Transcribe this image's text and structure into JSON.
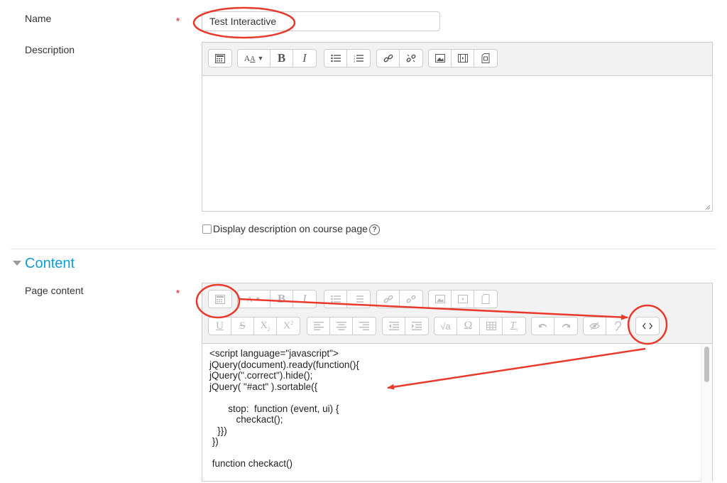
{
  "name_field": {
    "label": "Name",
    "required_marker": "*",
    "value": "Test Interactive"
  },
  "description_field": {
    "label": "Description"
  },
  "display_description": {
    "label": "Display description on course page",
    "checked": false,
    "help_icon": "question-circle-icon"
  },
  "content_section": {
    "title": "Content",
    "collapse_icon": "caret-down-icon"
  },
  "page_content": {
    "label": "Page content",
    "required_marker": "*",
    "code_lines": "<script language=\"javascript\">\njQuery(document).ready(function(){\njQuery(\".correct\").hide();\njQuery( \"#act\" ).sortable({\n\n       stop:  function (event, ui) {\n          checkact();\n   }})\n })\n\n function checkact()"
  },
  "toolbar_icons": {
    "row1": [
      "toolbar-toggle-icon",
      "font-color-icon",
      "bold-icon",
      "italic-icon",
      "unordered-list-icon",
      "ordered-list-icon",
      "link-icon",
      "unlink-icon",
      "image-icon",
      "media-icon",
      "manage-files-icon"
    ],
    "row2": [
      "underline-icon",
      "strikethrough-icon",
      "subscript-icon",
      "superscript-icon",
      "align-left-icon",
      "align-center-icon",
      "align-right-icon",
      "outdent-icon",
      "indent-icon",
      "equation-icon",
      "special-char-icon",
      "table-icon",
      "clear-format-icon",
      "undo-icon",
      "redo-icon",
      "accessibility-checker-icon",
      "screenreader-helper-icon",
      "html-source-icon"
    ]
  },
  "annotation_color": "#e8392b"
}
